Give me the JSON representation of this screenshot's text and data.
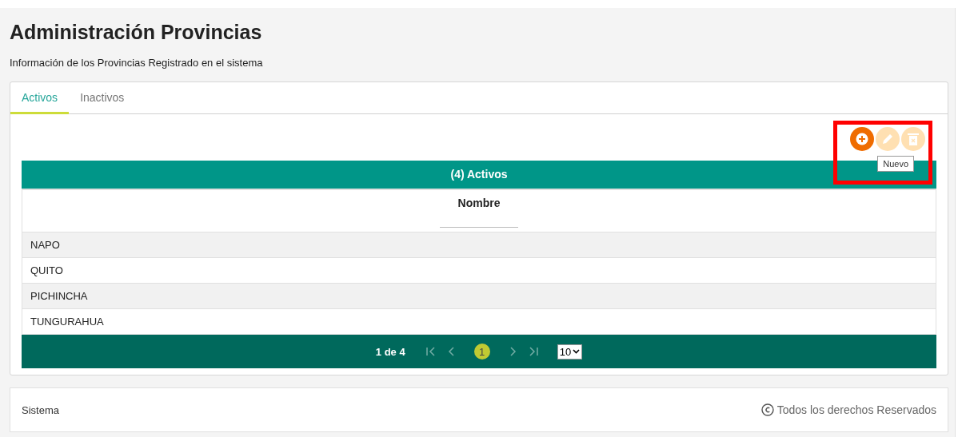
{
  "title": "Administración Provincias",
  "subtitle": "Información de los Provincias Registrado en el sistema",
  "tabs": [
    {
      "label": "Activos",
      "selected": true
    },
    {
      "label": "Inactivos",
      "selected": false
    }
  ],
  "toolbar": {
    "buttons": [
      {
        "kind": "add",
        "disabled": false
      },
      {
        "kind": "edit",
        "disabled": true
      },
      {
        "kind": "delete",
        "disabled": true
      }
    ],
    "tooltip": "Nuevo",
    "highlighted": true
  },
  "table": {
    "caption": "(4) Activos",
    "columns": [
      "Nombre"
    ],
    "rows": [
      [
        "NAPO"
      ],
      [
        "QUITO"
      ],
      [
        "PICHINCHA"
      ],
      [
        "TUNGURAHUA"
      ]
    ]
  },
  "paginator": {
    "report": "1 de 4",
    "pages": [
      {
        "label": "1",
        "selected": true
      }
    ],
    "page_size": "10"
  },
  "footer": {
    "left": "Sistema",
    "right": "Todos los derechos Reservados"
  }
}
